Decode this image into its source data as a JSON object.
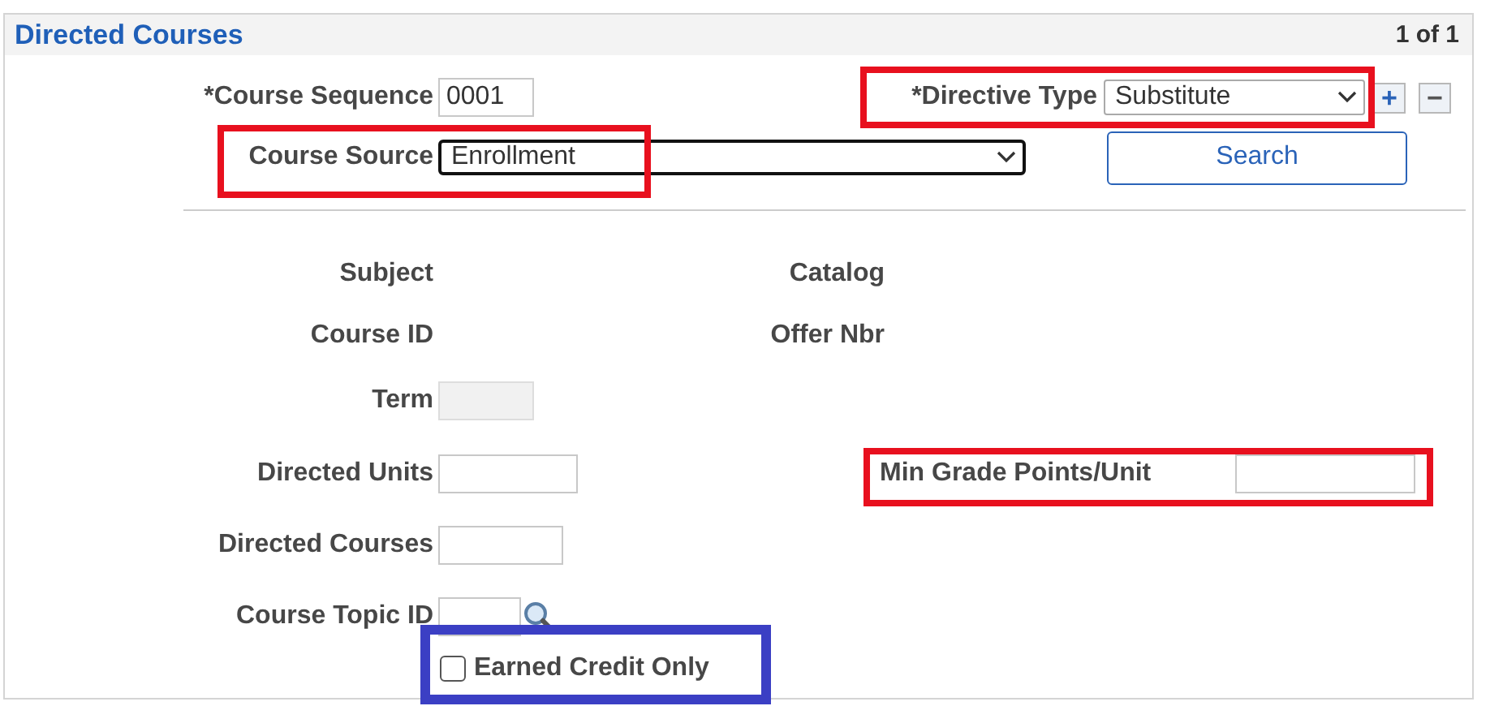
{
  "panel": {
    "title": "Directed Courses",
    "counter": "1 of 1"
  },
  "course_sequence": {
    "label": "*Course Sequence",
    "value": "0001"
  },
  "directive_type": {
    "label": "*Directive Type",
    "value": "Substitute",
    "color": "#e8101e"
  },
  "row_buttons": [
    "+",
    "−"
  ],
  "course_source": {
    "label": "Course Source",
    "value": "Enrollment",
    "color": "#e8101e"
  },
  "search_button": "Search",
  "info_rows": [
    {
      "label": "Subject",
      "label_2": "Catalog"
    },
    {
      "label": "Course ID",
      "label_2": "Offer Nbr"
    }
  ],
  "term": {
    "label": "Term",
    "disabled": true
  },
  "directed_units": {
    "label": "Directed Units"
  },
  "min_grade": {
    "label": "Min Grade Points/Unit",
    "color": "#e8101e"
  },
  "directed_courses": {
    "label": "Directed Courses"
  },
  "course_topic_id": {
    "label": "Course Topic ID"
  },
  "earned_credit_only": {
    "label": "Earned Credit Only",
    "checked": false,
    "color": "#3b3fc4"
  }
}
